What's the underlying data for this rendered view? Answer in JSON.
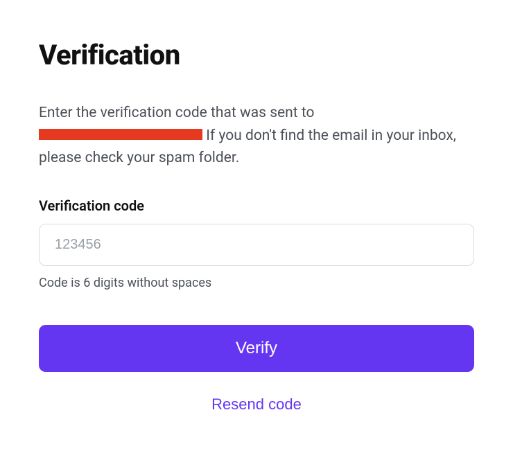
{
  "title": "Verification",
  "instructions": {
    "prefix": "Enter the verification code that was sent to ",
    "suffix": " If you don't find the email in your inbox, please check your spam folder."
  },
  "form": {
    "label": "Verification code",
    "placeholder": "123456",
    "hint": "Code is 6 digits without spaces"
  },
  "actions": {
    "verify": "Verify",
    "resend": "Resend code"
  }
}
